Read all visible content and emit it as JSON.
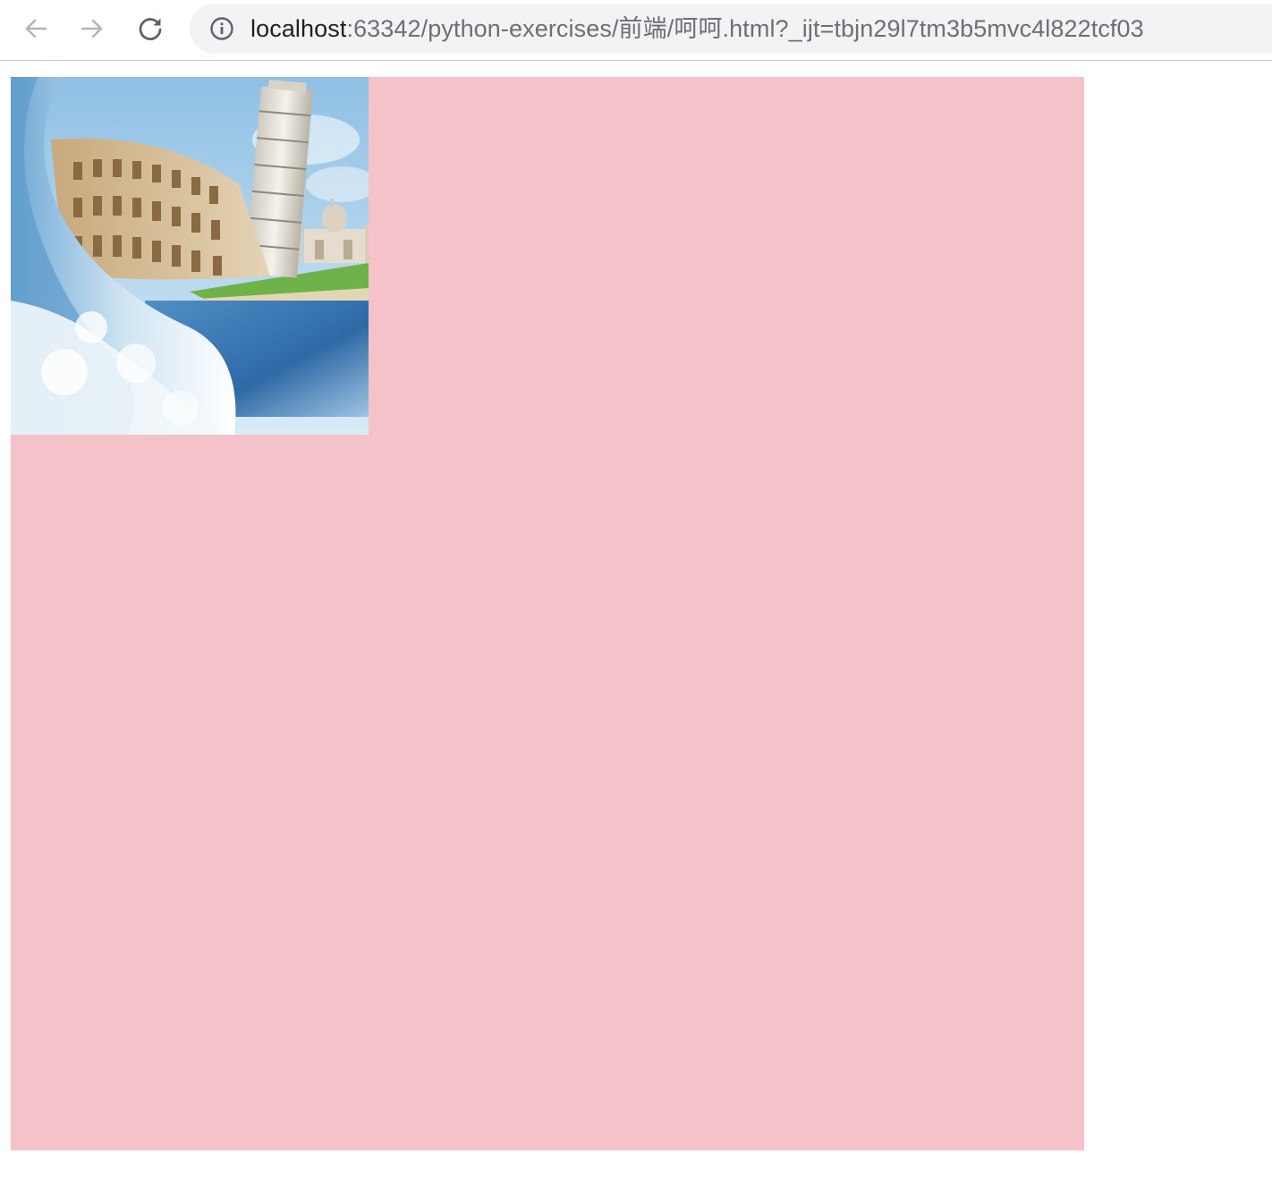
{
  "browser": {
    "address_bar": {
      "host": "localhost",
      "rest": ":63342/python-exercises/前端/呵呵.html?_ijt=tbjn29l7tm3b5mvc4l822tcf03"
    },
    "icons": {
      "back": "arrow-left-icon",
      "forward": "arrow-right-icon",
      "reload": "reload-icon",
      "site_info": "info-icon"
    }
  },
  "page": {
    "box_color": "#f5c2ca",
    "image": {
      "subject": "Colosseum, Leaning Tower of Pisa and Taj Mahal with a crashing ocean wave"
    }
  }
}
